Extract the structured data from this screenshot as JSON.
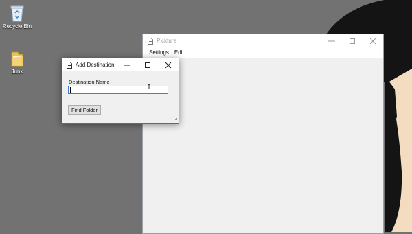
{
  "desktop": {
    "icons": [
      {
        "label": "Recycle Bin",
        "icon": "recycle-bin-icon"
      },
      {
        "label": "Junk",
        "icon": "folder-icon"
      }
    ]
  },
  "main_window": {
    "title": "Pickture",
    "menu": [
      "Settings",
      "Edit"
    ],
    "caption_buttons": [
      "minimize",
      "maximize",
      "close"
    ]
  },
  "dialog": {
    "title": "Add Destination",
    "field_label": "Destination Name",
    "field_value": "",
    "button_label": "Find Folder",
    "caption_buttons": [
      "minimize",
      "maximize",
      "close"
    ]
  },
  "colors": {
    "desktop_bg": "#727272",
    "wallpaper_dark": "#141414",
    "wallpaper_skin": "#f4dcc0",
    "input_focus": "#3c7fd6"
  }
}
